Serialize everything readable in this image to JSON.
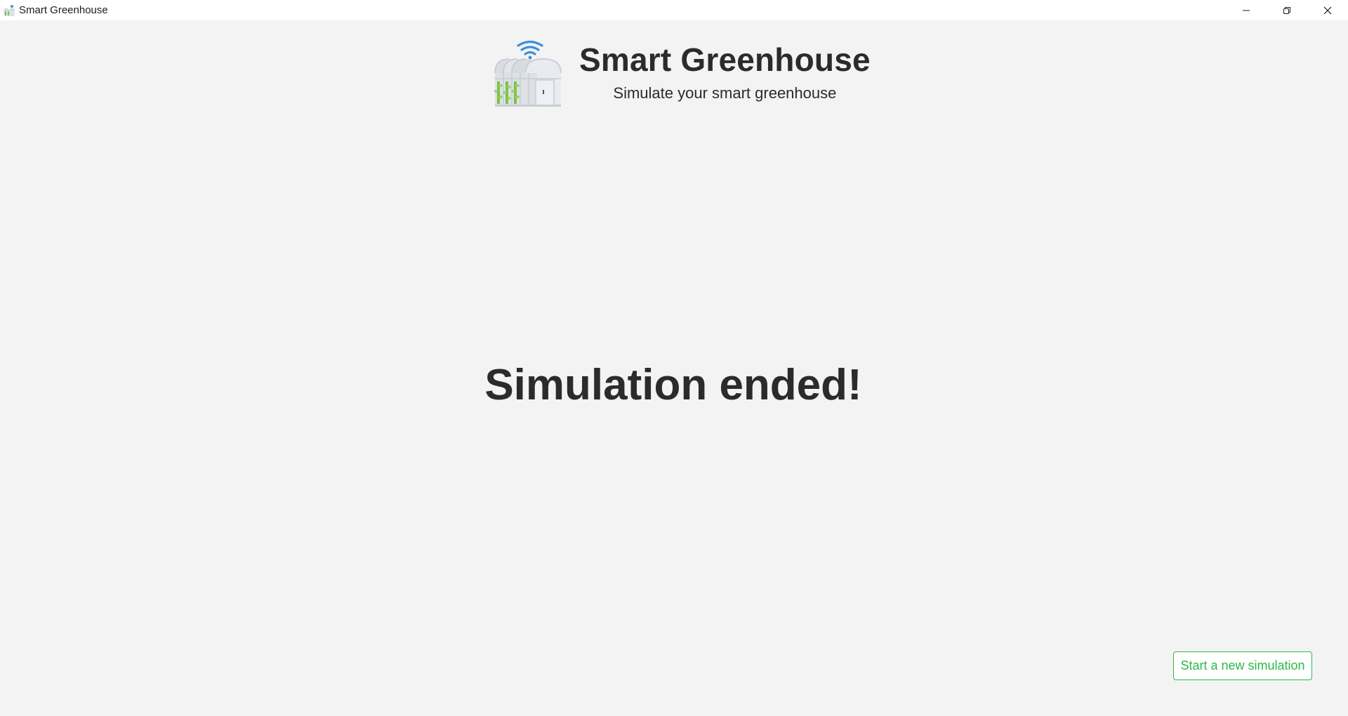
{
  "window": {
    "title": "Smart Greenhouse",
    "controls": {
      "minimize_icon": "minimize-icon",
      "restore_icon": "restore-icon",
      "close_icon": "close-icon"
    }
  },
  "header": {
    "logo_icon": "greenhouse-wifi-icon",
    "title": "Smart Greenhouse",
    "subtitle": "Simulate your smart greenhouse"
  },
  "main": {
    "message": "Simulation ended!"
  },
  "actions": {
    "new_simulation_label": "Start a new simulation"
  },
  "colors": {
    "background": "#f3f3f3",
    "text": "#2b2b2b",
    "accent_green": "#2db84a",
    "wifi_blue": "#3a8fdc"
  }
}
